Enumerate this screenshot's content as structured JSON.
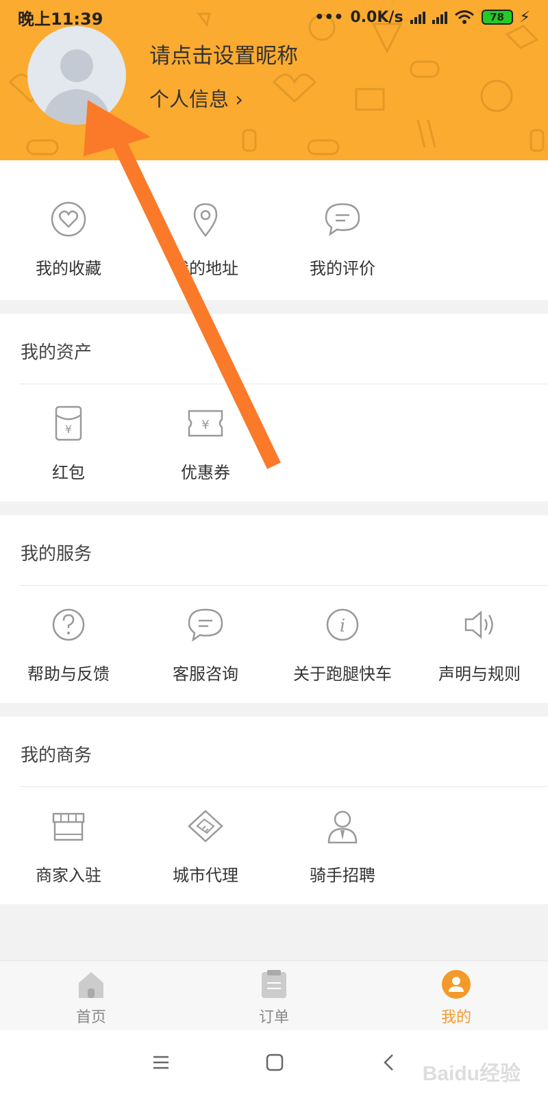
{
  "status_bar": {
    "time": "晚上11:39",
    "network_speed": "0.0K/s",
    "battery": "78"
  },
  "profile": {
    "nickname": "请点击设置昵称",
    "info_link": "个人信息",
    "info_chevron": "›"
  },
  "quick_actions": [
    {
      "label": "我的收藏",
      "icon": "heart-icon"
    },
    {
      "label": "我的地址",
      "icon": "location-pin-icon"
    },
    {
      "label": "我的评价",
      "icon": "comment-icon"
    }
  ],
  "assets": {
    "title": "我的资产",
    "items": [
      {
        "label": "红包",
        "icon": "red-packet-icon"
      },
      {
        "label": "优惠券",
        "icon": "coupon-icon"
      }
    ]
  },
  "services": {
    "title": "我的服务",
    "items": [
      {
        "label": "帮助与反馈",
        "icon": "help-icon"
      },
      {
        "label": "客服咨询",
        "icon": "chat-icon"
      },
      {
        "label": "关于跑腿快车",
        "icon": "info-icon"
      },
      {
        "label": "声明与规则",
        "icon": "speaker-icon"
      }
    ]
  },
  "business": {
    "title": "我的商务",
    "items": [
      {
        "label": "商家入驻",
        "icon": "store-icon"
      },
      {
        "label": "城市代理",
        "icon": "handshake-icon"
      },
      {
        "label": "骑手招聘",
        "icon": "person-tie-icon"
      }
    ]
  },
  "tabbar": [
    {
      "label": "首页",
      "icon": "home-icon",
      "active": false
    },
    {
      "label": "订单",
      "icon": "orders-icon",
      "active": false
    },
    {
      "label": "我的",
      "icon": "profile-icon",
      "active": true
    }
  ],
  "watermark": "Baidu经验",
  "colors": {
    "header": "#fbab30",
    "accent": "#f39a2a",
    "annotation_arrow": "#fa7a2a"
  }
}
